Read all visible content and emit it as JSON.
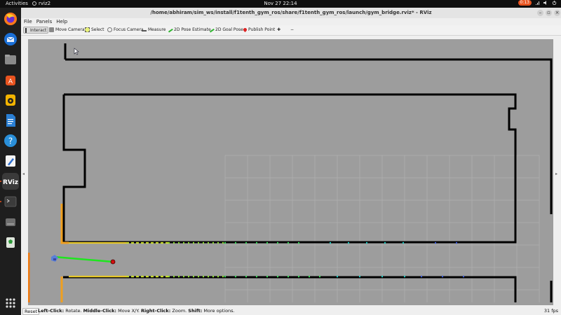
{
  "topbar": {
    "activities": "Activities",
    "app_name": "rviz2",
    "clock": "Nov 27  22:14",
    "badge": "0:13"
  },
  "dock": {
    "items": [
      "firefox-icon",
      "thunderbird-icon",
      "files-icon",
      "software-icon",
      "rhythmbox-icon",
      "writer-icon",
      "help-icon",
      "text-editor-icon",
      "rviz-icon",
      "terminal-icon",
      "drive-icon",
      "trash-icon",
      "app-grid-icon"
    ]
  },
  "window": {
    "title": "/home/abhiram/sim_ws/install/f1tenth_gym_ros/share/f1tenth_gym_ros/launch/gym_bridge.rviz* - RViz"
  },
  "menu": {
    "file": "File",
    "panels": "Panels",
    "help": "Help"
  },
  "toolbar": {
    "interact": "Interact",
    "move_camera": "Move Camera",
    "select": "Select",
    "focus_camera": "Focus Camera",
    "measure": "Measure",
    "pose_estimate": "2D Pose Estimate",
    "goal_pose": "2D Goal Pose",
    "publish_point": "Publish Point"
  },
  "status": {
    "reset": "Reset",
    "left_click": "Left-Click:",
    "left_text": " Rotate. ",
    "middle_click": "Middle-Click:",
    "middle_text": " Move X/Y. ",
    "right_click": "Right-Click:",
    "right_text": " Zoom. ",
    "shift": "Shift:",
    "shift_text": " More options.",
    "fps": "31 fps"
  },
  "colors": {
    "ubuntu_orange": "#e95420",
    "wall": "#000000",
    "floor": "#9c9c9c",
    "path_green": "#1ee61e",
    "goal_red": "#d01010"
  }
}
